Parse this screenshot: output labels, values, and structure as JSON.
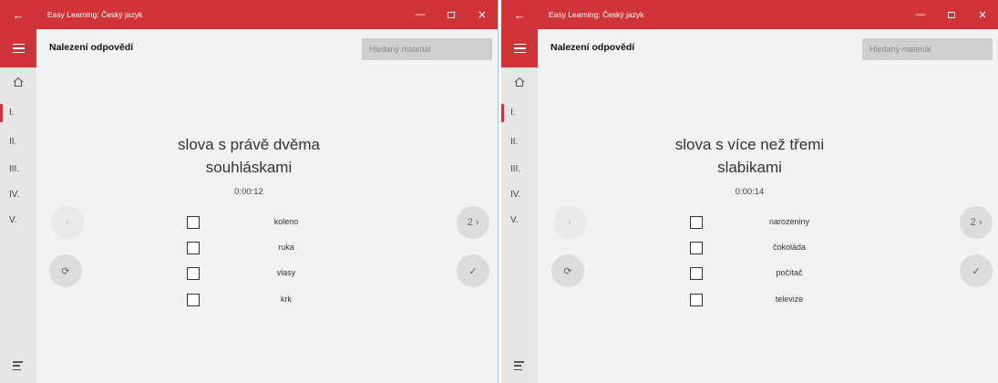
{
  "app_title": "Easy Learning: Český jazyk",
  "page_title": "Nalezení odpovědí",
  "search_placeholder": "Hledaný materiál",
  "nav_items": [
    "I.",
    "II.",
    "III.",
    "IV.",
    "V."
  ],
  "titlebar_icons": {
    "back": "←",
    "minimize": "—",
    "close": "✕"
  },
  "buttons": {
    "prev": "‹",
    "next": "2 ›",
    "reset": "⟳",
    "check": "✓"
  },
  "windows": [
    {
      "question_line1": "slova s právě dvěma",
      "question_line2": "souhláskami",
      "timer": "0:00:12",
      "options": [
        "koleno",
        "ruka",
        "vlasy",
        "krk"
      ]
    },
    {
      "question_line1": "slova s více než třemi",
      "question_line2": "slabikami",
      "timer": "0:00:14",
      "options": [
        "narozeniny",
        "čokoláda",
        "počítač",
        "televize"
      ]
    }
  ],
  "colors": {
    "accent": "#d13438",
    "background": "#f2f2f2",
    "rail": "#e6e6e6"
  }
}
